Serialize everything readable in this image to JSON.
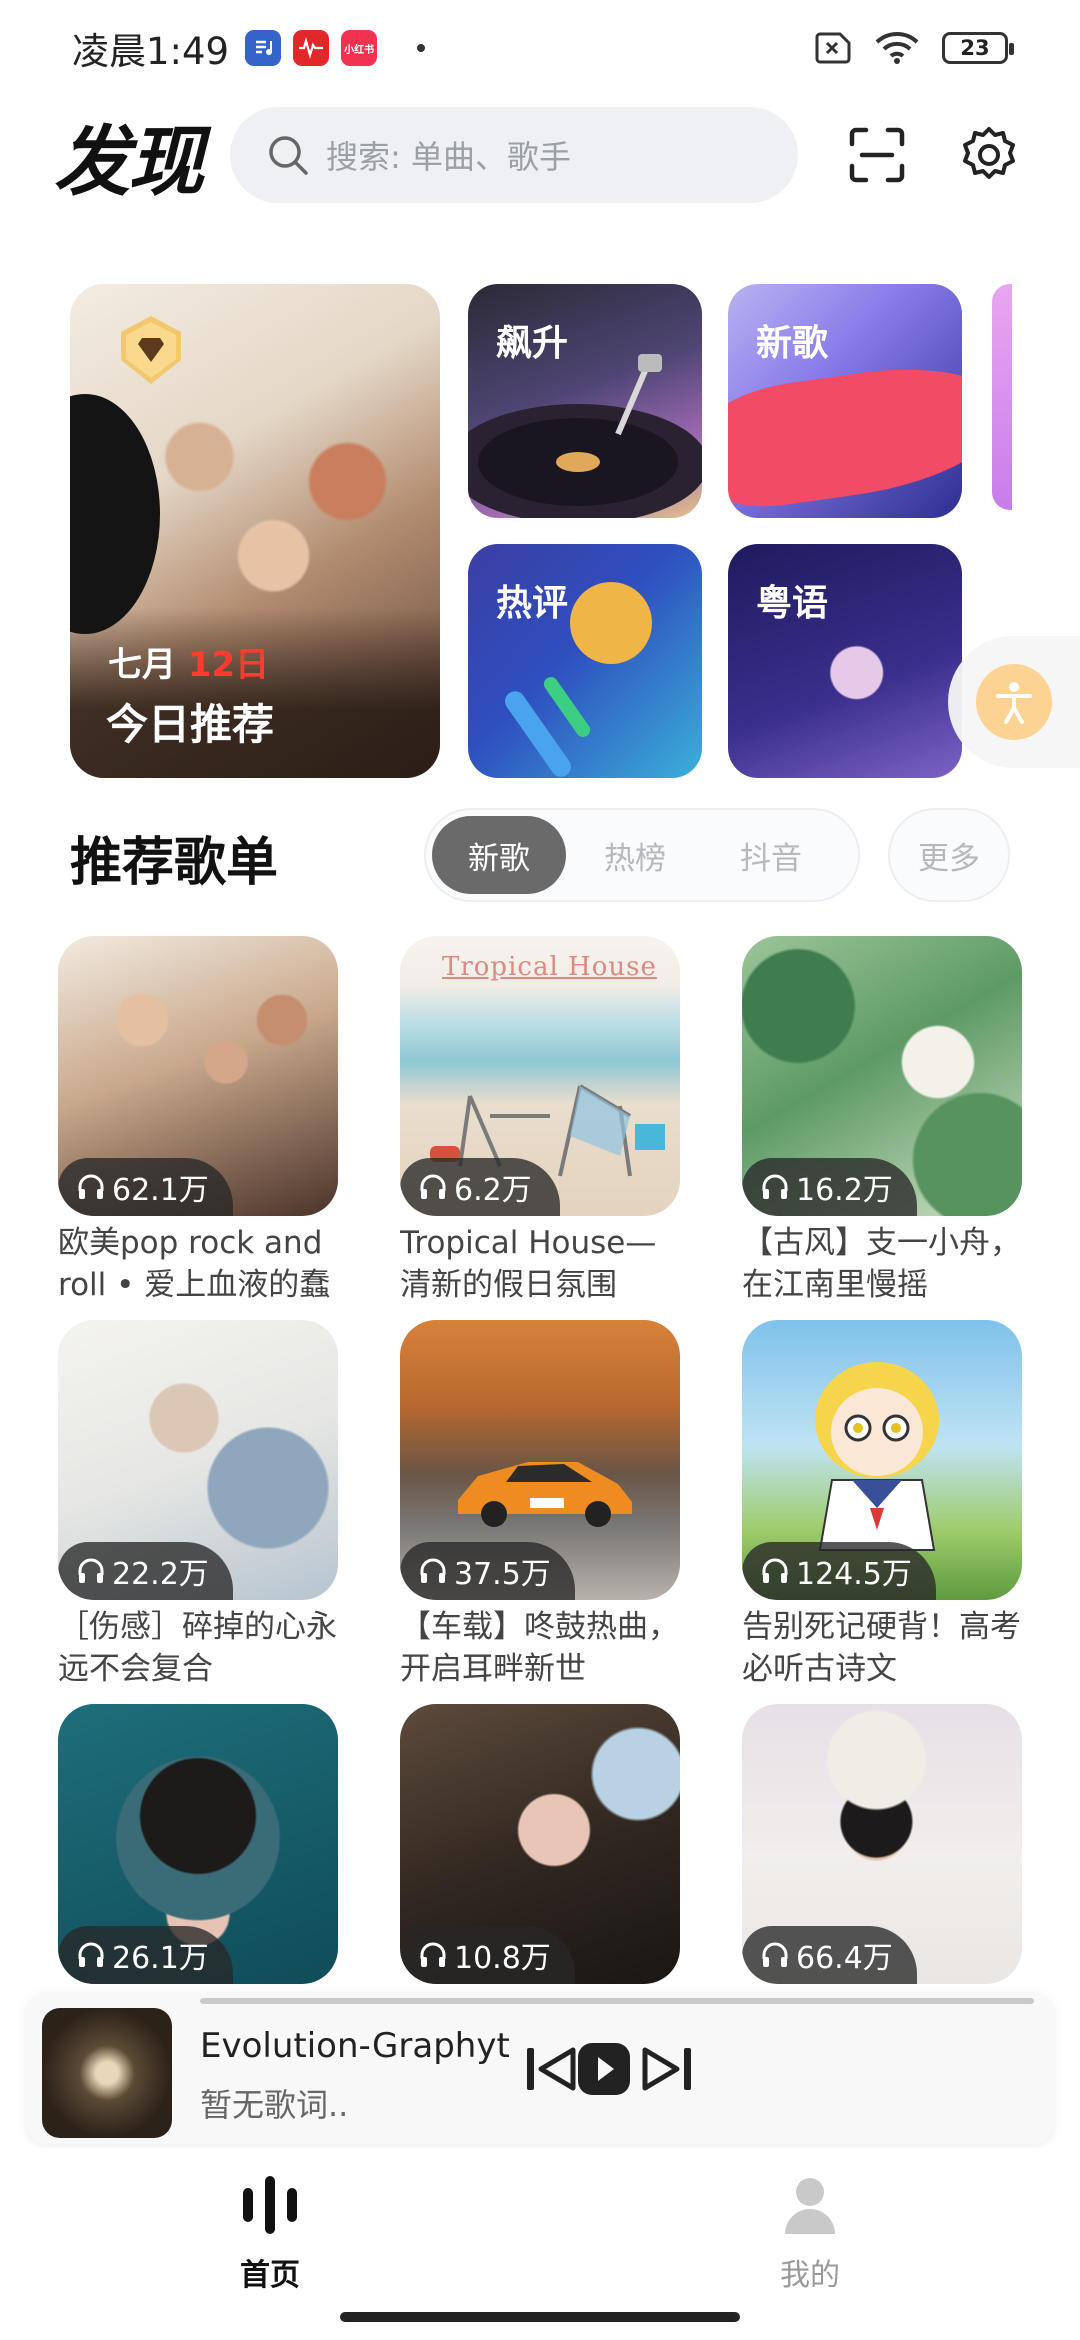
{
  "status_bar": {
    "time": "凌晨1:49",
    "app_badges": [
      "music",
      "waveform",
      "小红书"
    ],
    "battery": "23"
  },
  "header": {
    "title": "发现",
    "search_placeholder": "搜索: 单曲、歌手"
  },
  "daily": {
    "month": "七月",
    "day": "12日",
    "label": "今日推荐"
  },
  "tiles": {
    "rise": "飙升",
    "new": "新歌",
    "hot": "热评",
    "cantonese": "粤语"
  },
  "section": {
    "title": "推荐歌单",
    "tabs": [
      "新歌",
      "热榜",
      "抖音"
    ],
    "active_tab": "新歌",
    "more": "更多"
  },
  "playlists": [
    {
      "count": "62.1万",
      "title": "欧美pop rock and roll • 爱上血液的蠢"
    },
    {
      "count": "6.2万",
      "title": "Tropical House—清新的假日氛围"
    },
    {
      "count": "16.2万",
      "title": "【古风】支一小舟，在江南里慢摇"
    },
    {
      "count": "22.2万",
      "title": "［伤感］碎掉的心永远不会复合"
    },
    {
      "count": "37.5万",
      "title": "【车载】咚鼓热曲，开启耳畔新世"
    },
    {
      "count": "124.5万",
      "title": "告别死记硬背！高考必听古诗文"
    },
    {
      "count": "26.1万",
      "title": ""
    },
    {
      "count": "10.8万",
      "title": ""
    },
    {
      "count": "66.4万",
      "title": ""
    }
  ],
  "cover_text": {
    "tropical": "Tropical House"
  },
  "player": {
    "song": "Evolution-Graphyt",
    "lyric": "暂无歌词..",
    "progress": 0
  },
  "nav": {
    "home": "首页",
    "mine": "我的",
    "active": "home"
  },
  "colors": {
    "accent_red": "#ff3b30",
    "search_bg": "#eef0f3",
    "active_tab_bg": "#6a6a6a"
  }
}
